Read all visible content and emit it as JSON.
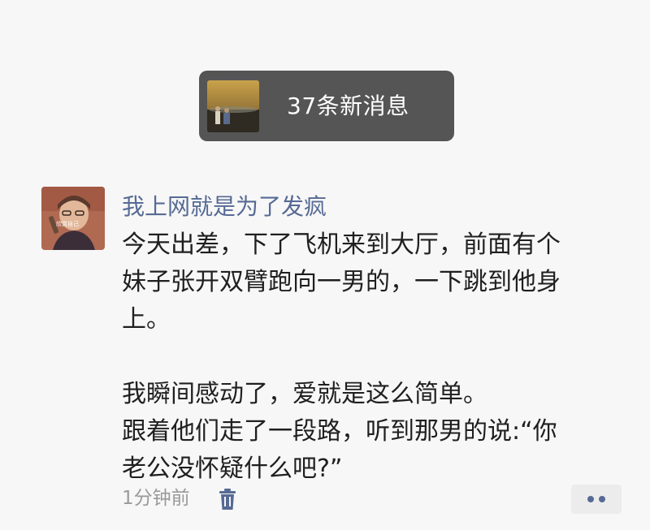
{
  "notification": {
    "text": "37条新消息",
    "thumbnail_icon": "photo-thumbnail"
  },
  "post": {
    "username": "我上网就是为了发疯",
    "avatar_icon": "user-avatar",
    "avatar_caption": "欣赏自己",
    "paragraphs": [
      [
        "今天出差，下了飞机来到大厅，前面有个",
        "妹子张开双臂跑向一男的，一下跳到他身",
        "上。"
      ],
      [
        "我瞬间感动了，爱就是这么简单。",
        "跟着他们走了一段路，听到那男的说:“你",
        "老公没怀疑什么吧?”"
      ]
    ],
    "timestamp": "1分钟前",
    "delete_icon": "trash-icon",
    "more_icon": "more-dots-icon"
  },
  "colors": {
    "background": "#f7f7f7",
    "toast_bg": "#555555",
    "username": "#566a94",
    "body_text": "#1f1f1f",
    "meta_text": "#9a9a9a"
  }
}
